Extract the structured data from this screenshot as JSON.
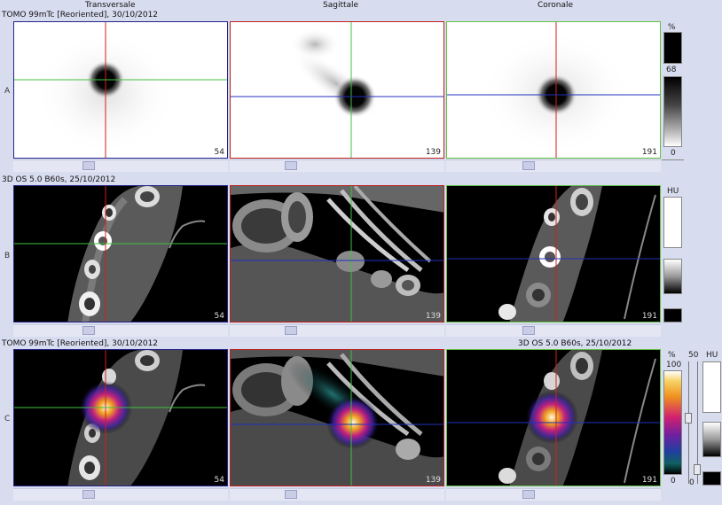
{
  "header": {
    "view1": "Transversale",
    "view2": "Sagittale",
    "view3": "Coronale"
  },
  "rows": {
    "a": {
      "label": "A",
      "series": "TOMO 99mTc [Reoriented], 30/10/2012"
    },
    "b": {
      "label": "B",
      "series": "3D  OS  5.0  B60s, 25/10/2012"
    },
    "c": {
      "label": "C",
      "series_left": "TOMO 99mTc [Reoriented], 30/10/2012",
      "series_right": "3D  OS  5.0  B60s, 25/10/2012"
    }
  },
  "slices": {
    "trans": "54",
    "sag": "139",
    "cor": "191"
  },
  "colorbars": {
    "a": {
      "unit": "%",
      "mid": "68",
      "min": "0"
    },
    "b": {
      "unit": "HU"
    },
    "c": {
      "pct_unit": "%",
      "pct_max": "100",
      "pct_min": "0",
      "level": "50",
      "hu_unit": "HU",
      "hu_min": "0"
    }
  },
  "colors": {
    "bg": "#d8dcef",
    "transversal_border": "#23238a",
    "sagittal_border": "#c02020",
    "coronal_border": "#60c040",
    "crosshair_red": "#d02020",
    "crosshair_green": "#40c040",
    "crosshair_blue": "#2030c0"
  }
}
